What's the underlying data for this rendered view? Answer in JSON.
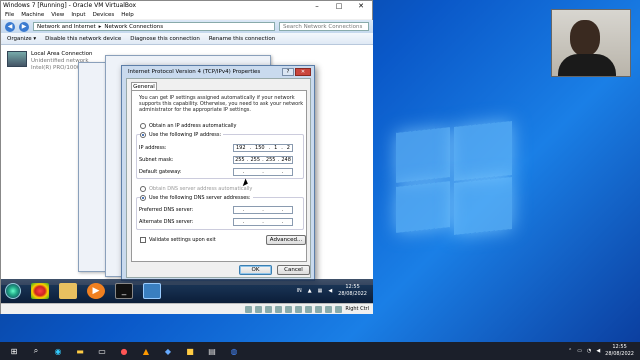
{
  "host": {
    "taskbar": {
      "icons": [
        "windows-start-icon",
        "search-icon",
        "edge-icon",
        "explorer-icon",
        "terminal-icon",
        "chrome-icon",
        "vlc-icon",
        "virtualbox-icon",
        "app-icon",
        "notepad-icon",
        "settings-icon"
      ],
      "time": "12:55",
      "date": "28/08/2022"
    }
  },
  "vbox": {
    "title": "Windows 7 [Running] - Oracle VM VirtualBox",
    "menu": [
      "File",
      "Machine",
      "View",
      "Input",
      "Devices",
      "Help"
    ],
    "status_right": "Right Ctrl"
  },
  "explorer": {
    "breadcrumb": [
      "Network and Internet",
      "Network Connections"
    ],
    "search_placeholder": "Search Network Connections",
    "commands": [
      "Organize ▾",
      "Disable this network device",
      "Diagnose this connection",
      "Rename this connection"
    ],
    "connection": {
      "name": "Local Area Connection",
      "status": "Unidentified network",
      "adapter": "Intel(R) PRO/1000 MT Desk"
    }
  },
  "dialog": {
    "title": "Internet Protocol Version 4 (TCP/IPv4) Properties",
    "tab": "General",
    "description": "You can get IP settings assigned automatically if your network supports this capability. Otherwise, you need to ask your network administrator for the appropriate IP settings.",
    "radio_auto_ip": "Obtain an IP address automatically",
    "radio_manual_ip": "Use the following IP address:",
    "ip_label": "IP address:",
    "ip_value": [
      "192",
      "150",
      "1",
      "2"
    ],
    "mask_label": "Subnet mask:",
    "mask_value": [
      "255",
      "255",
      "255",
      "248"
    ],
    "gateway_label": "Default gateway:",
    "radio_auto_dns": "Obtain DNS server address automatically",
    "radio_manual_dns": "Use the following DNS server addresses:",
    "pref_dns_label": "Preferred DNS server:",
    "alt_dns_label": "Alternate DNS server:",
    "validate_label": "Validate settings upon exit",
    "advanced_button": "Advanced...",
    "ok_button": "OK",
    "cancel_button": "Cancel"
  },
  "guest_taskbar": {
    "lang": "IN",
    "time": "12:55",
    "date": "28/08/2022"
  }
}
